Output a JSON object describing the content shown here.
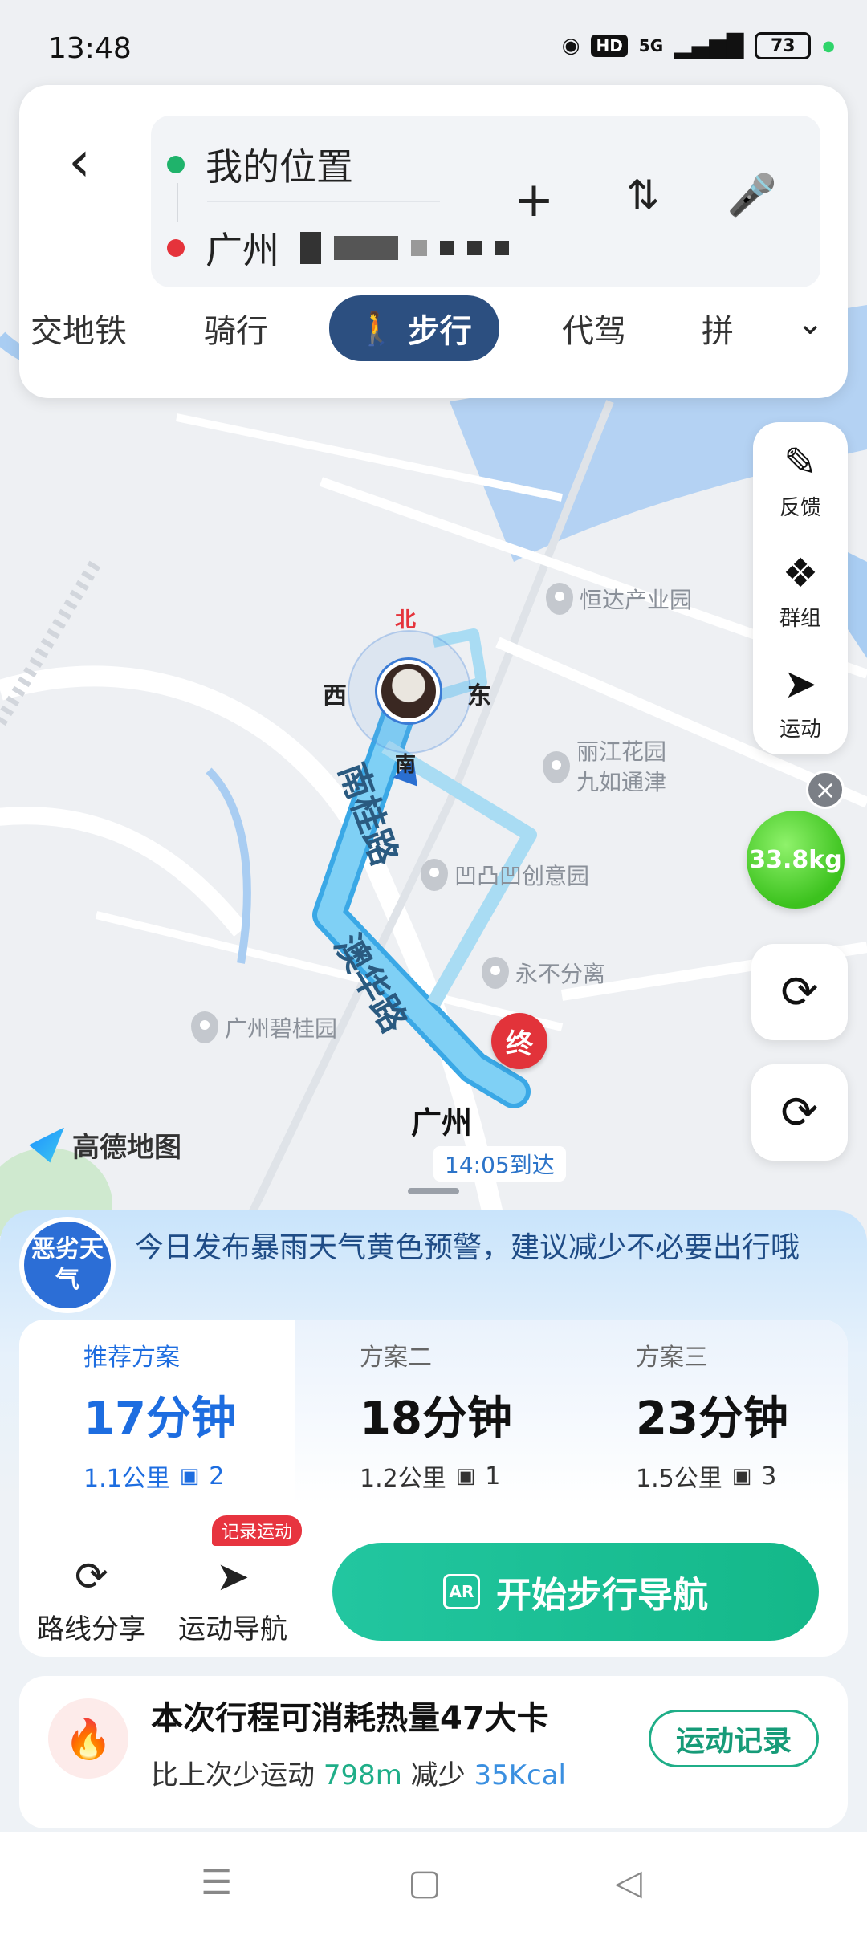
{
  "status_bar": {
    "time": "13:48",
    "network": "5G",
    "hd": "HD",
    "battery": "73"
  },
  "route": {
    "start": "我的位置",
    "end": "广州",
    "start_color": "#1fb36b",
    "end_color": "#e5333b"
  },
  "modes": {
    "items": [
      "交地铁",
      "骑行",
      "步行",
      "代驾",
      "拼"
    ],
    "active": "步行"
  },
  "side_tools": {
    "feedback": "反馈",
    "group": "群组",
    "sport": "运动"
  },
  "weight": "33.8kg",
  "map": {
    "pois": [
      "恒达产业园",
      "丽江花园",
      "九如通津",
      "凹凸凹创意园",
      "永不分离",
      "广州碧桂园"
    ],
    "roads": [
      "南桂路",
      "澳华路"
    ],
    "compass": {
      "north": "北",
      "south": "南",
      "east": "东",
      "west": "西"
    },
    "end_marker": "终",
    "dest_label": "广州",
    "arrive": "14:05到达",
    "logo": "高德地图"
  },
  "warning": {
    "badge": "恶劣天气",
    "text": "今日发布暴雨天气黄色预警，建议减少不必要出行哦"
  },
  "plans": [
    {
      "name": "推荐方案",
      "time": "17分钟",
      "distance": "1.1公里",
      "lights": "2"
    },
    {
      "name": "方案二",
      "time": "18分钟",
      "distance": "1.2公里",
      "lights": "1"
    },
    {
      "name": "方案三",
      "time": "23分钟",
      "distance": "1.5公里",
      "lights": "3"
    }
  ],
  "actions": {
    "share": "路线分享",
    "sport_nav": "运动导航",
    "record_badge": "记录运动",
    "start": "开始步行导航",
    "ar": "AR"
  },
  "calorie": {
    "title": "本次行程可消耗热量47大卡",
    "prefix": "比上次少运动",
    "distance": "798m",
    "mid": "减少",
    "kcal": "35Kcal",
    "button": "运动记录"
  }
}
